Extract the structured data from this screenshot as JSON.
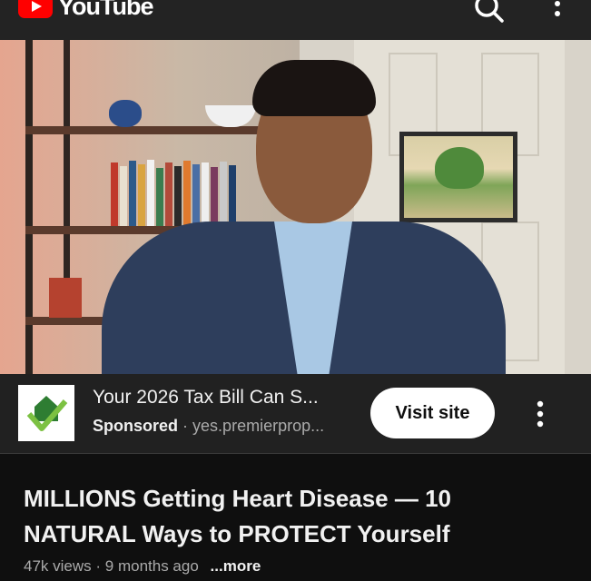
{
  "header": {
    "logo_text": "YouTube",
    "search_icon": "search-icon",
    "menu_icon": "more-vert-icon"
  },
  "ad": {
    "title": "Your 2026 Tax Bill Can S...",
    "sponsored_label": "Sponsored",
    "separator": "·",
    "domain": "yes.premierprop...",
    "cta_label": "Visit site",
    "menu_icon": "more-vert-icon"
  },
  "video": {
    "title": "MILLIONS Getting Heart Disease — 10 NATURAL Ways to PROTECT Yourself",
    "views": "47k views",
    "separator": "·",
    "age": "9 months ago",
    "more_label": "...more"
  },
  "colors": {
    "brand_red": "#ff0000",
    "background": "#0f0f0f",
    "ad_bar": "#212121",
    "secondary_text": "#aaaaaa"
  }
}
